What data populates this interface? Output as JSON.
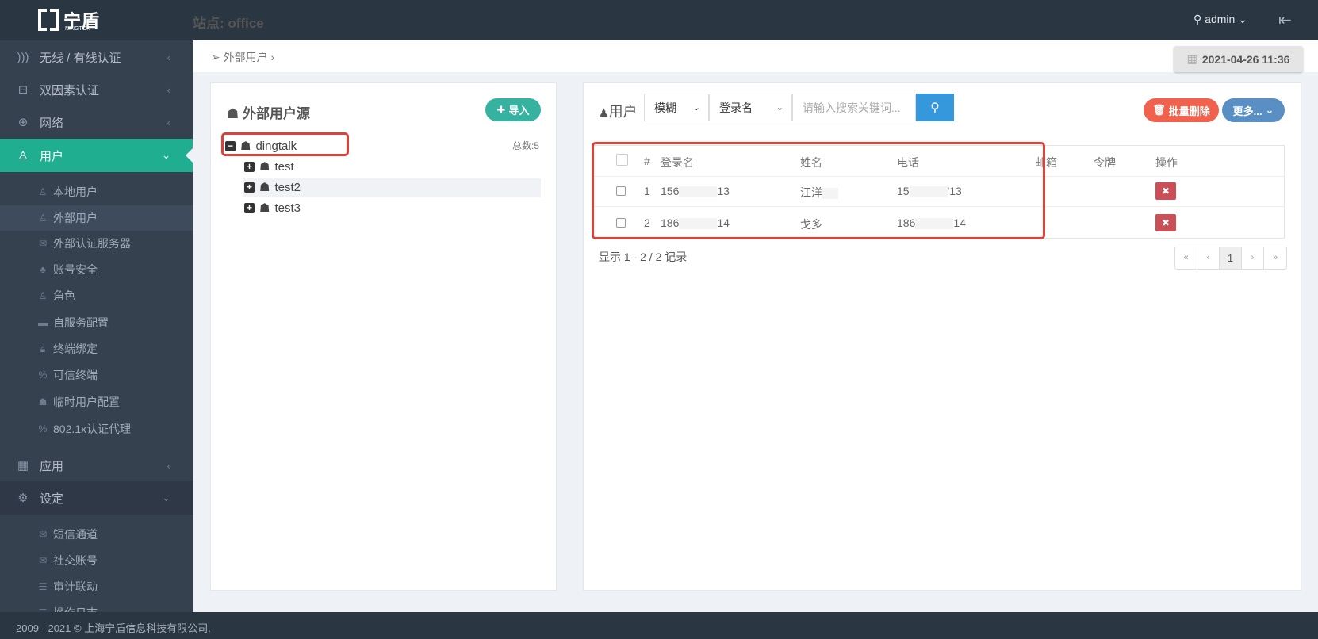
{
  "header": {
    "logo_cn": "宁盾",
    "logo_en": "NINGTON",
    "site": "站点: office",
    "user": "admin",
    "user_icon": "user-icon",
    "logout_icon": "logout-icon"
  },
  "sidebar": {
    "items": [
      {
        "label": "无线 / 有线认证",
        "icon": "wifi-icon"
      },
      {
        "label": "双因素认证",
        "icon": "briefcase-icon"
      },
      {
        "label": "网络",
        "icon": "globe-icon"
      },
      {
        "label": "用户",
        "icon": "user-icon"
      },
      {
        "label": "应用",
        "icon": "grid-icon"
      },
      {
        "label": "设定",
        "icon": "gear-icon"
      }
    ],
    "user_sub": [
      "本地用户",
      "外部用户",
      "外部认证服务器",
      "账号安全",
      "角色",
      "自服务配置",
      "终端绑定",
      "可信终端",
      "临时用户配置",
      "802.1x认证代理"
    ],
    "settings_sub": [
      "短信通道",
      "社交账号",
      "审计联动",
      "操作日志"
    ]
  },
  "breadcrumb": {
    "current": "外部用户"
  },
  "datetime": "2021-04-26 11:36",
  "left_panel": {
    "title": "外部用户源",
    "import_label": "导入",
    "total": "总数:5",
    "tree": {
      "root": "dingtalk",
      "children": [
        "test",
        "test2",
        "test3"
      ]
    }
  },
  "right_panel": {
    "title": "用户",
    "match_mode": "模糊",
    "field": "登录名",
    "search_placeholder": "请输入搜索关键词...",
    "batch_delete": "批量删除",
    "more": "更多...",
    "columns": [
      "#",
      "登录名",
      "姓名",
      "电话",
      "邮箱",
      "令牌",
      "操作"
    ],
    "rows": [
      {
        "index": "1",
        "login_prefix": "156",
        "login_suffix": "13",
        "name": "江洋",
        "phone_prefix": "15",
        "phone_suffix": "'13"
      },
      {
        "index": "2",
        "login_prefix": "186",
        "login_suffix": "14",
        "name": "戈多",
        "phone_prefix": "186",
        "phone_suffix": "14"
      }
    ],
    "info": "显示 1 - 2 / 2 记录",
    "pager": [
      "«",
      "‹",
      "1",
      "›",
      "»"
    ]
  },
  "footer": "2009 - 2021 © 上海宁盾信息科技有限公司."
}
